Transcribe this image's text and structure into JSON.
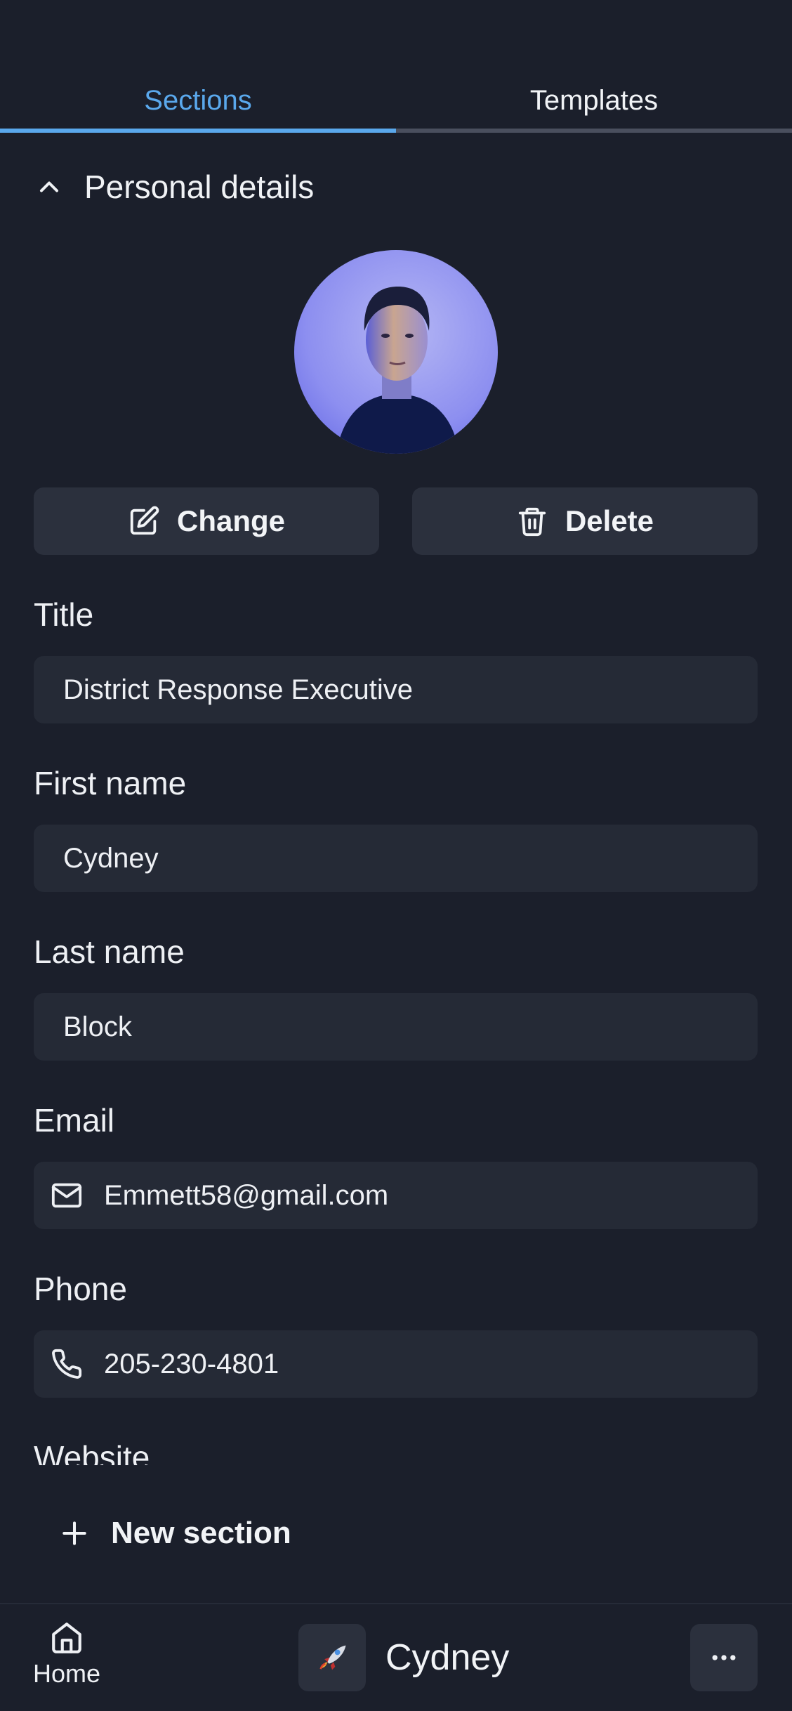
{
  "tabs": {
    "sections": "Sections",
    "templates": "Templates"
  },
  "section": {
    "title": "Personal details"
  },
  "photo_actions": {
    "change": "Change",
    "delete": "Delete"
  },
  "fields": {
    "title": {
      "label": "Title",
      "value": "District Response Executive"
    },
    "first_name": {
      "label": "First name",
      "value": "Cydney"
    },
    "last_name": {
      "label": "Last name",
      "value": "Block"
    },
    "email": {
      "label": "Email",
      "value": "Emmett58@gmail.com"
    },
    "phone": {
      "label": "Phone",
      "value": "205-230-4801"
    },
    "website": {
      "label": "Website"
    }
  },
  "new_section": "New section",
  "bottom_nav": {
    "home": "Home",
    "profile_name": "Cydney"
  },
  "colors": {
    "background": "#1b1f2b",
    "accent": "#5aa8ec",
    "field_bg": "#252a36",
    "button_bg": "#2b303d"
  },
  "icons": {
    "chevron": "chevron-up-icon",
    "change": "edit-icon",
    "delete": "trash-icon",
    "email": "mail-icon",
    "phone": "phone-icon",
    "new_section": "plus-icon",
    "home": "home-icon",
    "profile": "rocket-icon",
    "more": "more-horizontal-icon"
  }
}
